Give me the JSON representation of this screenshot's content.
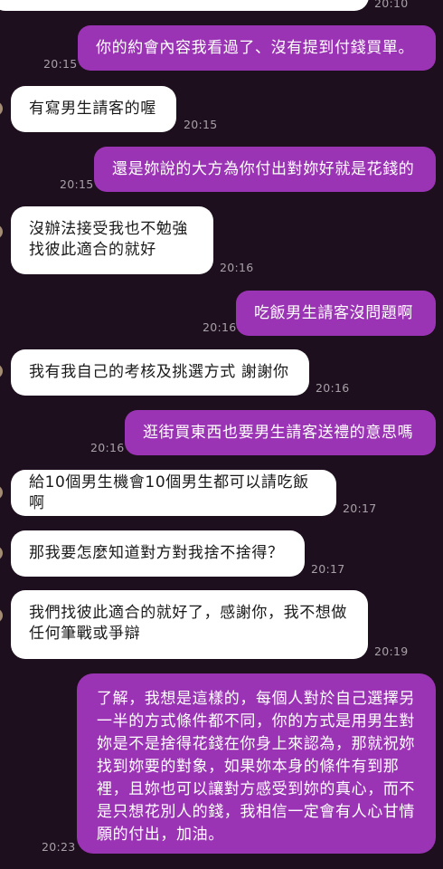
{
  "messages": [
    {
      "side": "in",
      "text": "",
      "time": "20:10"
    },
    {
      "side": "out",
      "text": "你的約會內容我看過了、沒有提到付錢買單。",
      "time": "20:15"
    },
    {
      "side": "in",
      "text": "有寫男生請客的喔",
      "time": "20:15"
    },
    {
      "side": "out",
      "text": "還是妳說的大方為你付出對妳好就是花錢的",
      "time": "20:15"
    },
    {
      "side": "in",
      "text": "沒辦法接受我也不勉強\n找彼此適合的就好",
      "time": "20:16"
    },
    {
      "side": "out",
      "text": "吃飯男生請客沒問題啊",
      "time": "20:16"
    },
    {
      "side": "in",
      "text": "我有我自己的考核及挑選方式 謝謝你",
      "time": "20:16"
    },
    {
      "side": "out",
      "text": "逛街買東西也要男生請客送禮的意思嗎",
      "time": "20:16"
    },
    {
      "side": "in",
      "text": "給10個男生機會10個男生都可以請吃飯啊",
      "time": "20:17"
    },
    {
      "side": "in",
      "text": "那我要怎麼知道對方對我捨不捨得？",
      "time": "20:17"
    },
    {
      "side": "in",
      "text": "我們找彼此適合的就好了，感謝你，我不想做\n任何筆戰或爭辯",
      "time": "20:19"
    },
    {
      "side": "out",
      "text": "了解，我想是這樣的，每個人對於自己選擇另\n一半的方式條件都不同，你的方式是用男生對\n妳是不是捨得花錢在你身上來認為，那就祝妳\n找到妳要的對象，如果妳本身的條件有到那\n裡，且妳也可以讓對方感受到妳的真心，而不\n是只想花別人的錢，我相信一定會有人心甘情\n願的付出，加油。",
      "time": "20:23"
    }
  ]
}
